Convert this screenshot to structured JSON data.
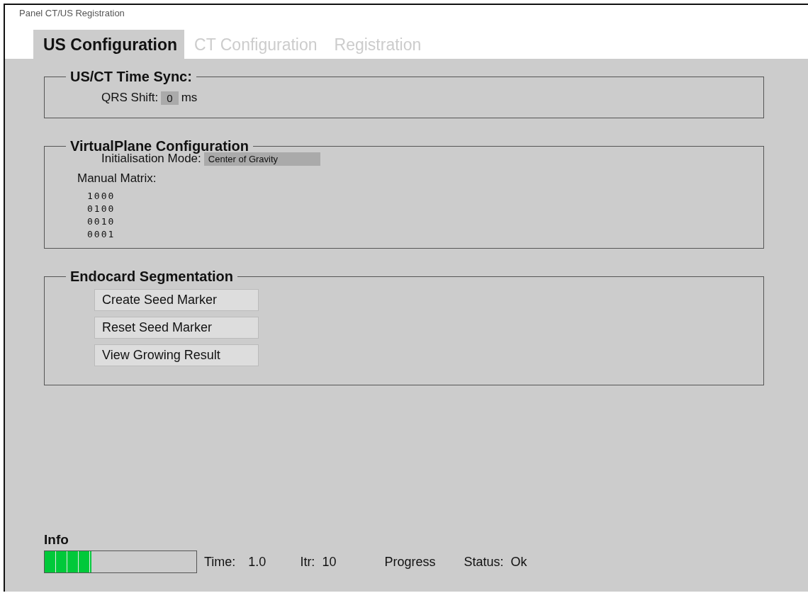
{
  "window": {
    "title": "Panel CT/US Registration"
  },
  "tabs": [
    {
      "label": "US Configuration",
      "selected": true
    },
    {
      "label": "CT Configuration",
      "selected": false
    },
    {
      "label": "Registration",
      "selected": false
    }
  ],
  "time_sync": {
    "title": "US/CT Time Sync:",
    "label": "QRS Shift:",
    "value": "0",
    "unit": "ms"
  },
  "virtual_plane": {
    "title": "VirtualPlane Configuration",
    "mode_label": "Initialisation Mode:",
    "mode_value": "Center of Gravity",
    "matrix_label": "Manual Matrix:",
    "matrix_rows": [
      "1000",
      "0100",
      "0010",
      "0001"
    ]
  },
  "segmentation": {
    "title": "Endocard Segmentation",
    "buttons": [
      "Create Seed Marker",
      "Reset Seed Marker",
      "View Growing Result"
    ]
  },
  "info": {
    "title": "Info",
    "progress": {
      "level": 0.31
    },
    "time_label": "Time:",
    "time_value": "1.0",
    "itr_label": "Itr:",
    "itr_value": "10",
    "progress_label": "Progress",
    "status_label": "Status:",
    "status_value": "Ok"
  }
}
